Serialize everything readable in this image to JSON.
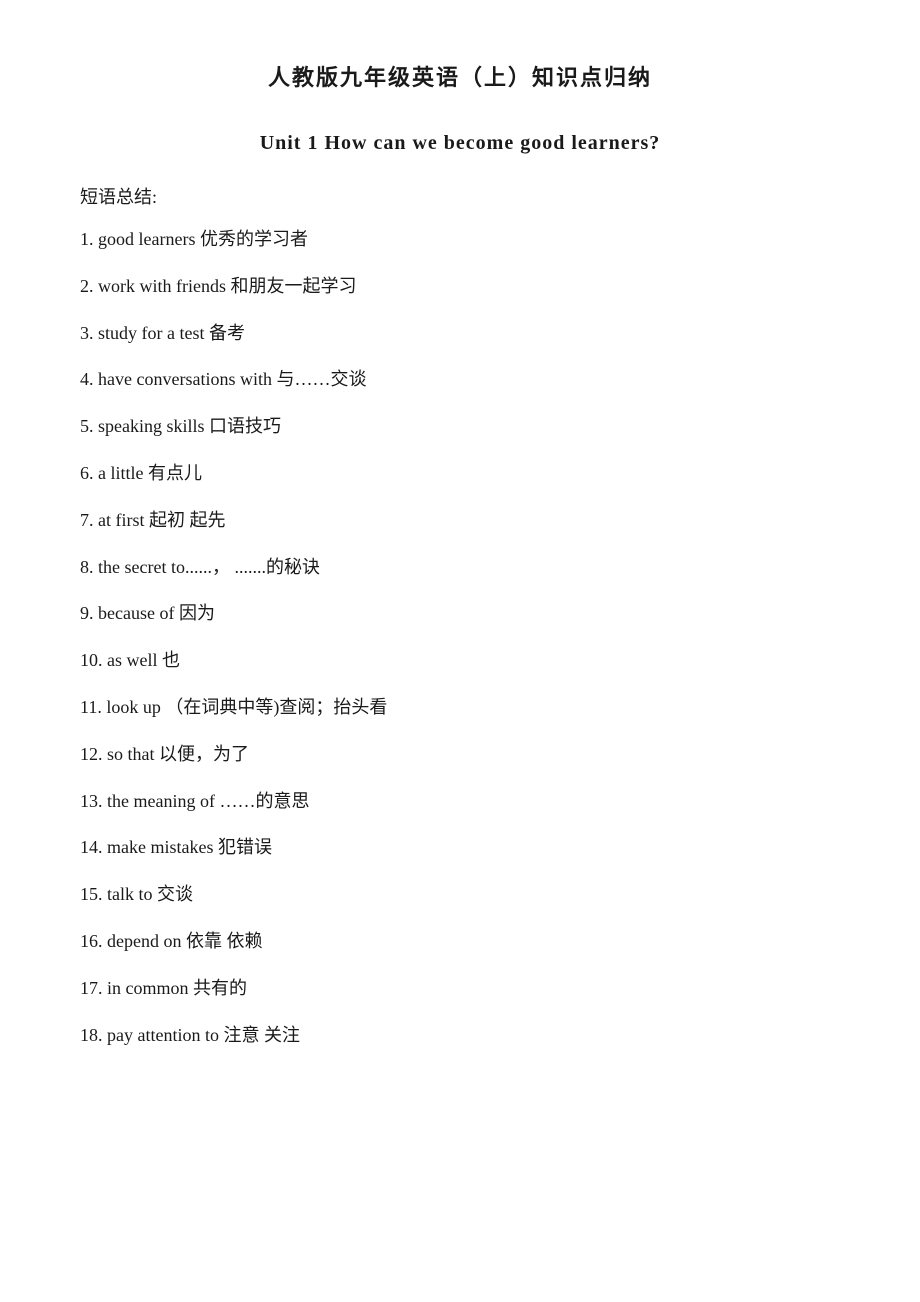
{
  "page": {
    "title": "人教版九年级英语（上）知识点归纳",
    "unit_heading": "Unit 1    How can we become good learners?",
    "section_label": "短语总结:",
    "phrases": [
      {
        "number": "1.",
        "en": "good learners",
        "zh": "优秀的学习者"
      },
      {
        "number": "2.",
        "en": "work with friends",
        "zh": "和朋友一起学习"
      },
      {
        "number": "3.",
        "en": "study for a test",
        "zh": "备考"
      },
      {
        "number": "4.",
        "en": "have conversations with",
        "zh": "与……交谈"
      },
      {
        "number": "5.",
        "en": "speaking skills",
        "zh": "口语技巧"
      },
      {
        "number": "6.",
        "en": "a little",
        "zh": "有点儿"
      },
      {
        "number": "7.",
        "en": "at first",
        "zh": "起初   起先"
      },
      {
        "number": "8.",
        "en": "the   secret to......，",
        "zh": ".......的秘诀"
      },
      {
        "number": "9.",
        "en": "because of",
        "zh": "因为"
      },
      {
        "number": "10.",
        "en": "as well",
        "zh": "也"
      },
      {
        "number": "11.",
        "en": "look up",
        "zh": "（在词典中等)查阅；抬头看"
      },
      {
        "number": "12.",
        "en": "so that",
        "zh": "以便，为了"
      },
      {
        "number": "13.",
        "en": "the meaning   of",
        "zh": "……的意思"
      },
      {
        "number": "14.",
        "en": "make mistakes",
        "zh": "犯错误"
      },
      {
        "number": "15.",
        "en": "talk to",
        "zh": "交谈"
      },
      {
        "number": "16.",
        "en": "depend on",
        "zh": "依靠   依赖"
      },
      {
        "number": "17.",
        "en": "in common",
        "zh": "共有的"
      },
      {
        "number": "18.",
        "en": "pay attention   to",
        "zh": "注意 关注"
      }
    ]
  }
}
